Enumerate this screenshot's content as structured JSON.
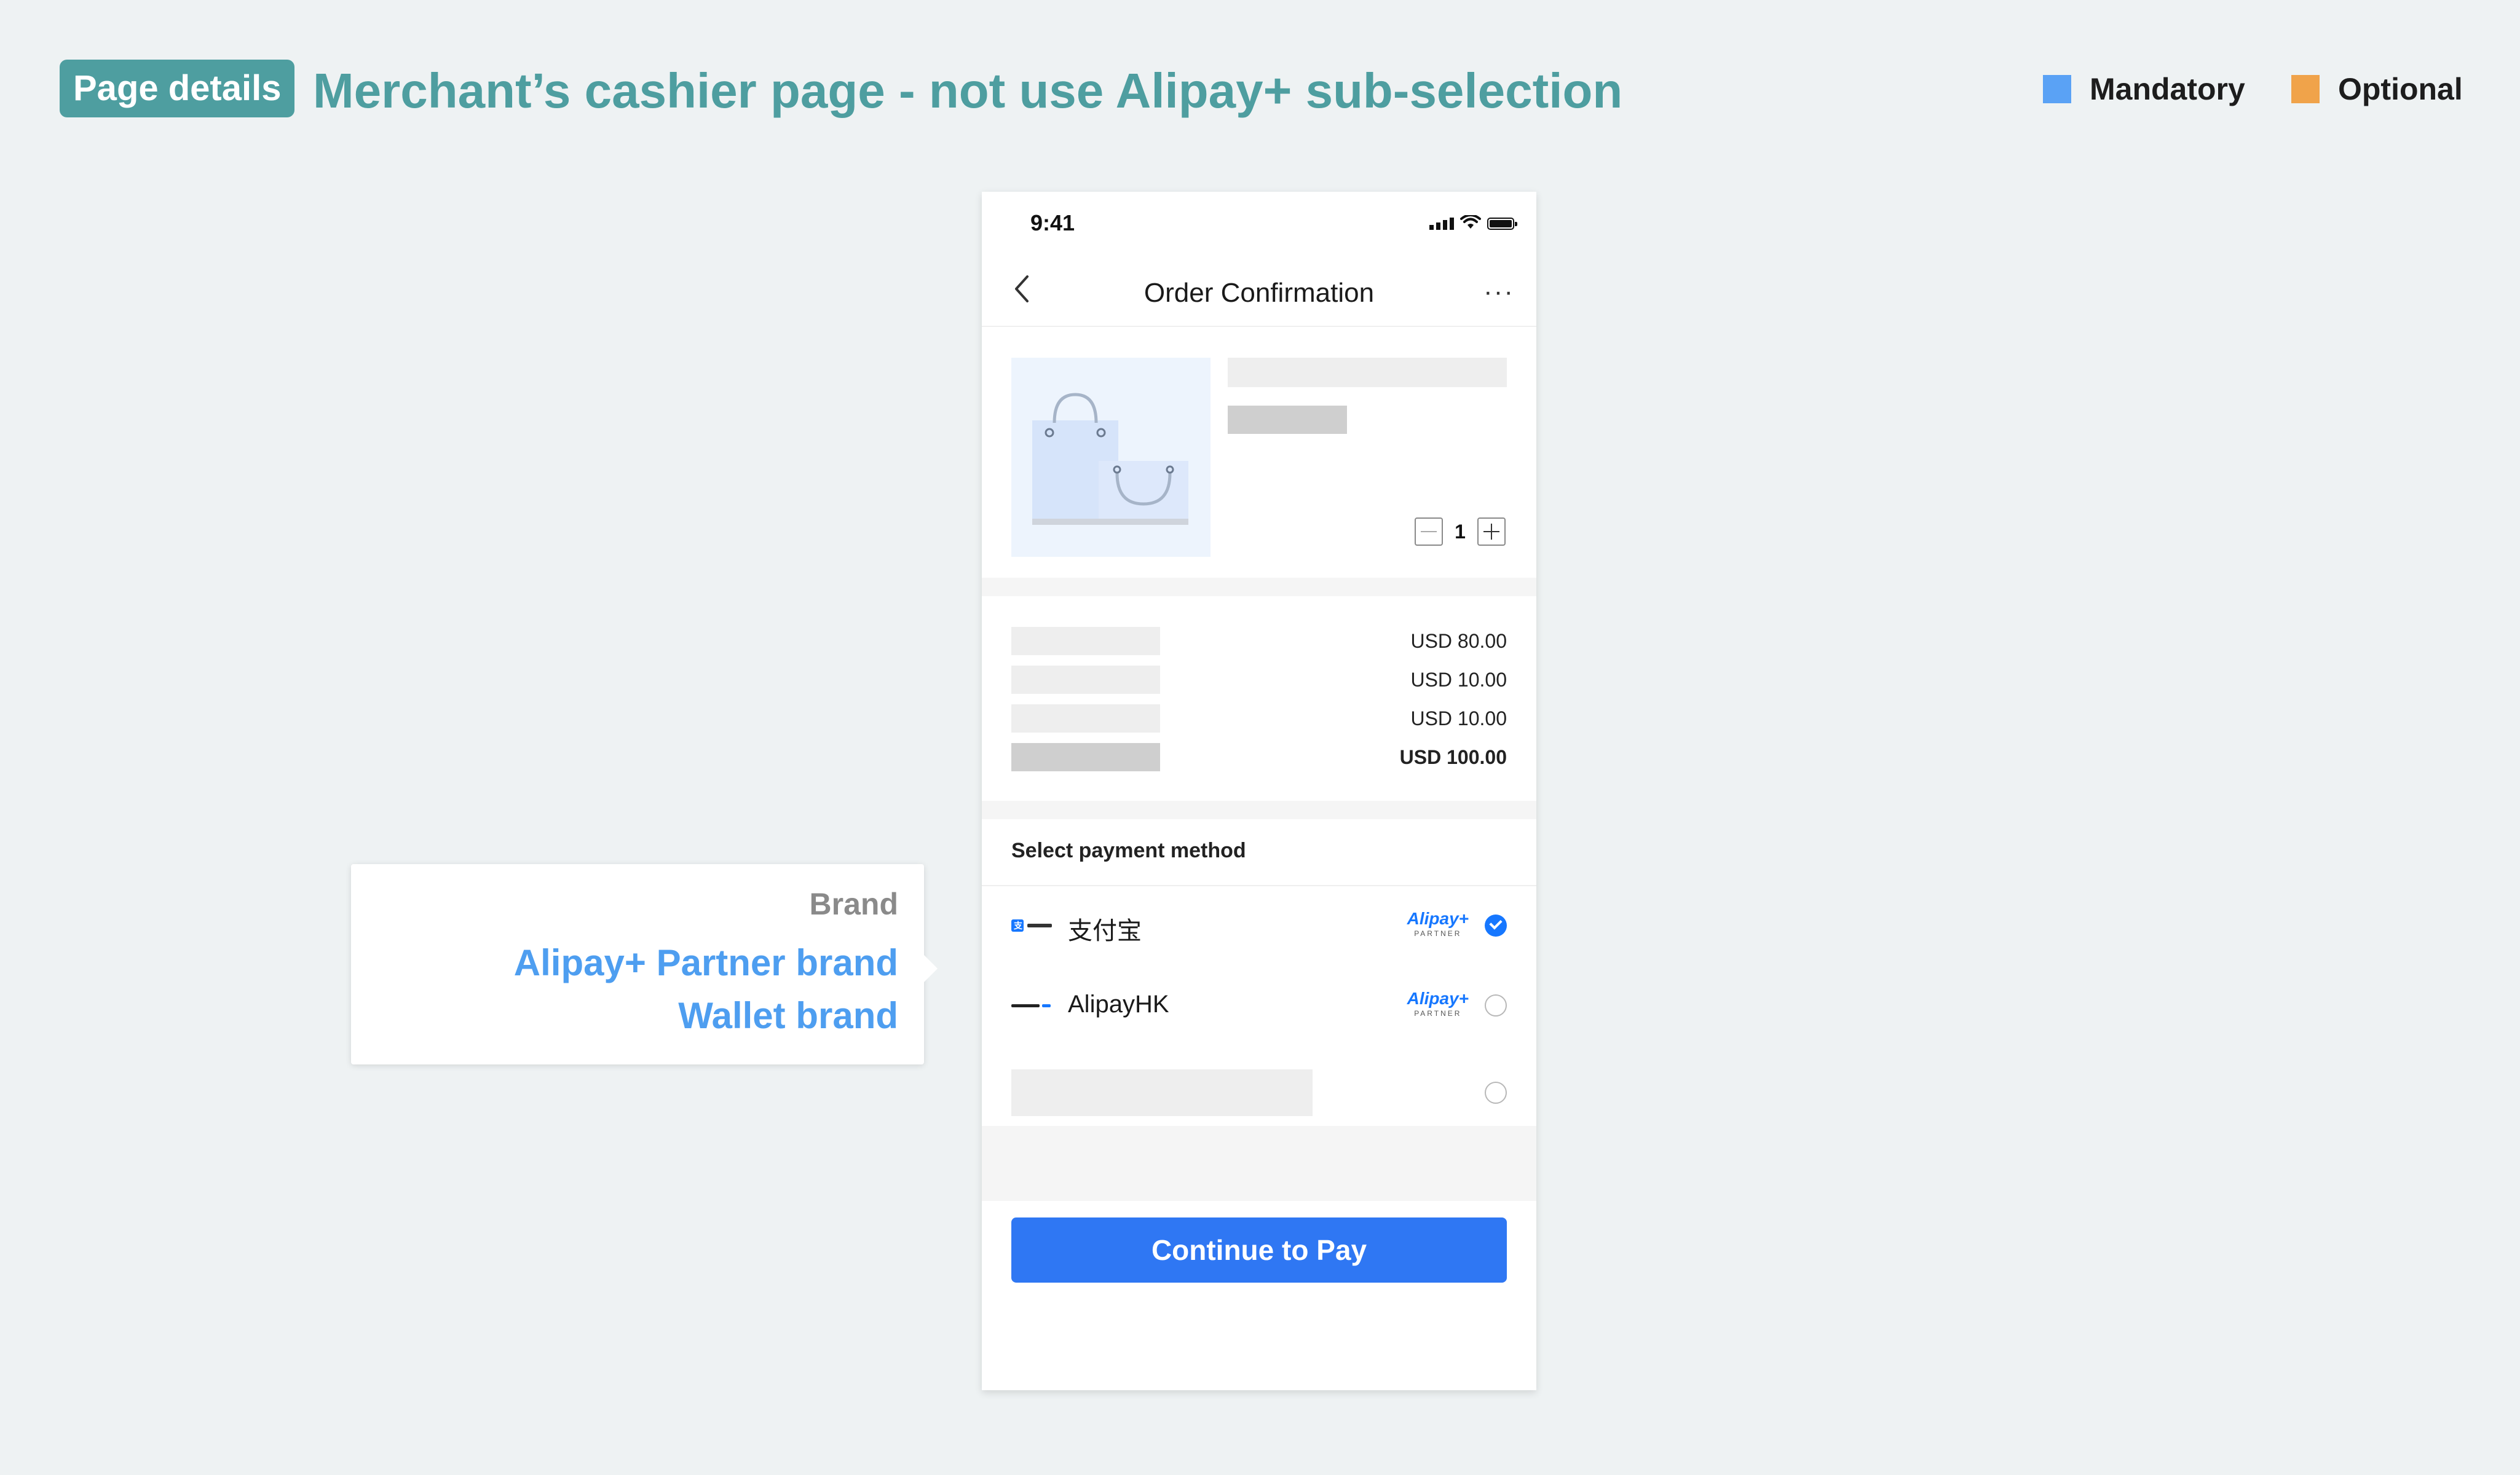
{
  "header": {
    "tag": "Page details",
    "title": "Merchant’s cashier page - not use Alipay+ sub-selection"
  },
  "legend": [
    {
      "label": "Mandatory",
      "color": "#5aa2f5"
    },
    {
      "label": "Optional",
      "color": "#f0a34a"
    }
  ],
  "phone": {
    "status": {
      "time": "9:41"
    },
    "nav": {
      "title": "Order Confirmation",
      "more": "···"
    },
    "product": {
      "quantity": "1"
    },
    "amounts": [
      "USD 80.00",
      "USD 10.00",
      "USD 10.00",
      "USD 100.00"
    ],
    "payment": {
      "header": "Select payment method",
      "methods": [
        {
          "name": "支付宝",
          "logo": "alipay-logo",
          "partner_top": "Alipay+",
          "partner_bottom": "PARTNER",
          "selected": true
        },
        {
          "name": "AlipayHK",
          "logo": "alipayhk-logo",
          "partner_top": "Alipay+",
          "partner_bottom": "PARTNER",
          "selected": false
        }
      ]
    },
    "button": "Continue to Pay"
  },
  "callout": {
    "title": "Brand",
    "lines": [
      "Alipay+ Partner brand",
      "Wallet brand"
    ]
  }
}
